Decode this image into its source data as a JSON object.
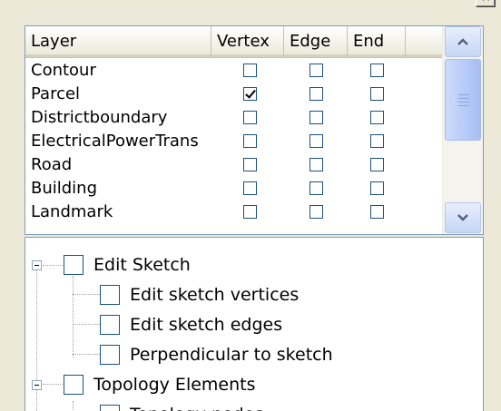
{
  "window": {
    "close_glyph": "×"
  },
  "grid": {
    "columns": [
      "Layer",
      "Vertex",
      "Edge",
      "End"
    ],
    "rows": [
      {
        "name": "Contour",
        "vertex": false,
        "edge": false,
        "end": false
      },
      {
        "name": "Parcel",
        "vertex": true,
        "edge": false,
        "end": false
      },
      {
        "name": "Districtboundary",
        "vertex": false,
        "edge": false,
        "end": false
      },
      {
        "name": "ElectricalPowerTrans",
        "vertex": false,
        "edge": false,
        "end": false
      },
      {
        "name": "Road",
        "vertex": false,
        "edge": false,
        "end": false
      },
      {
        "name": "Building",
        "vertex": false,
        "edge": false,
        "end": false
      },
      {
        "name": "Landmark",
        "vertex": false,
        "edge": false,
        "end": false
      }
    ],
    "scroll_up_icon": "chevron-up-icon",
    "scroll_down_icon": "chevron-down-icon"
  },
  "tree": {
    "nodes": [
      {
        "label": "Edit Sketch",
        "level": 0,
        "expanded": true
      },
      {
        "label": "Edit sketch vertices",
        "level": 1
      },
      {
        "label": "Edit sketch edges",
        "level": 1
      },
      {
        "label": "Perpendicular to sketch",
        "level": 1
      },
      {
        "label": "Topology Elements",
        "level": 0,
        "expanded": true
      },
      {
        "label": "Topology nodes",
        "level": 1
      }
    ]
  },
  "colors": {
    "scroll_arrow": "#4d6185",
    "check": "#000000",
    "border": "#7f9db9"
  }
}
